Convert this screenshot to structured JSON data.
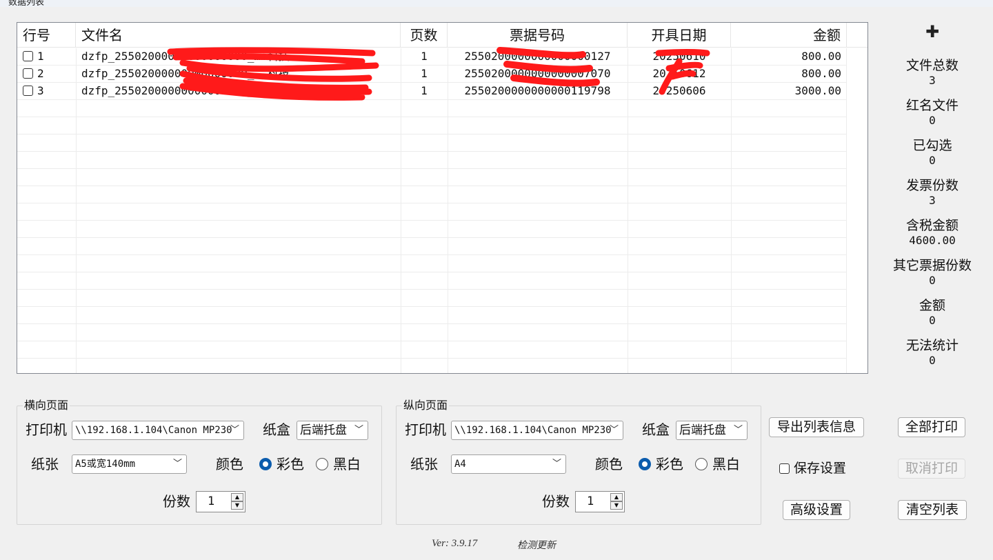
{
  "window": {
    "title": "数据列表"
  },
  "table": {
    "headers": [
      "行号",
      "文件名",
      "页数",
      "票据号码",
      "开具日期",
      "金额"
    ],
    "rows": [
      {
        "index": "1",
        "filename": "dzfp_25502000000000000000_……科技...",
        "pages": "1",
        "number": "2550200000000000000127",
        "date": "20250610",
        "amount": "800.00"
      },
      {
        "index": "2",
        "filename": "dzfp_25502000000000000000_……科技...",
        "pages": "1",
        "number": "2550200000000000007070",
        "date": "20250612",
        "amount": "800.00"
      },
      {
        "index": "3",
        "filename": "dzfp_25502000000000000000_……有限...",
        "pages": "1",
        "number": "2550200000000000119798",
        "date": "20250606",
        "amount": "3000.00"
      }
    ]
  },
  "stats": [
    {
      "label": "文件总数",
      "value": "3"
    },
    {
      "label": "红名文件",
      "value": "0"
    },
    {
      "label": "已勾选",
      "value": "0"
    },
    {
      "label": "发票份数",
      "value": "3"
    },
    {
      "label": "含税金额",
      "value": "4600.00"
    },
    {
      "label": "其它票据份数",
      "value": "0"
    },
    {
      "label": "金额",
      "value": "0"
    },
    {
      "label": "无法统计",
      "value": "0"
    }
  ],
  "landscape": {
    "title": "横向页面",
    "printer_label": "打印机",
    "printer": "\\\\192.168.1.104\\Canon MP230",
    "tray_label": "纸盒",
    "tray": "后端托盘",
    "paper_label": "纸张",
    "paper": "A5或宽140mm",
    "color_label": "颜色",
    "color_option": "彩色",
    "bw_option": "黑白",
    "copies_label": "份数",
    "copies": "1"
  },
  "portrait": {
    "title": "纵向页面",
    "printer_label": "打印机",
    "printer": "\\\\192.168.1.104\\Canon MP230",
    "tray_label": "纸盒",
    "tray": "后端托盘",
    "paper_label": "纸张",
    "paper": "A4",
    "color_label": "颜色",
    "color_option": "彩色",
    "bw_option": "黑白",
    "copies_label": "份数",
    "copies": "1"
  },
  "actions": {
    "export": "导出列表信息",
    "print_all": "全部打印",
    "save_settings": "保存设置",
    "cancel_print": "取消打印",
    "advanced": "高级设置",
    "clear_list": "清空列表"
  },
  "footer": {
    "version": "Ver: 3.9.17",
    "check_update": "检测更新"
  },
  "colors": {
    "accent": "#0b5cad",
    "redaction": "#ff1a1a"
  }
}
